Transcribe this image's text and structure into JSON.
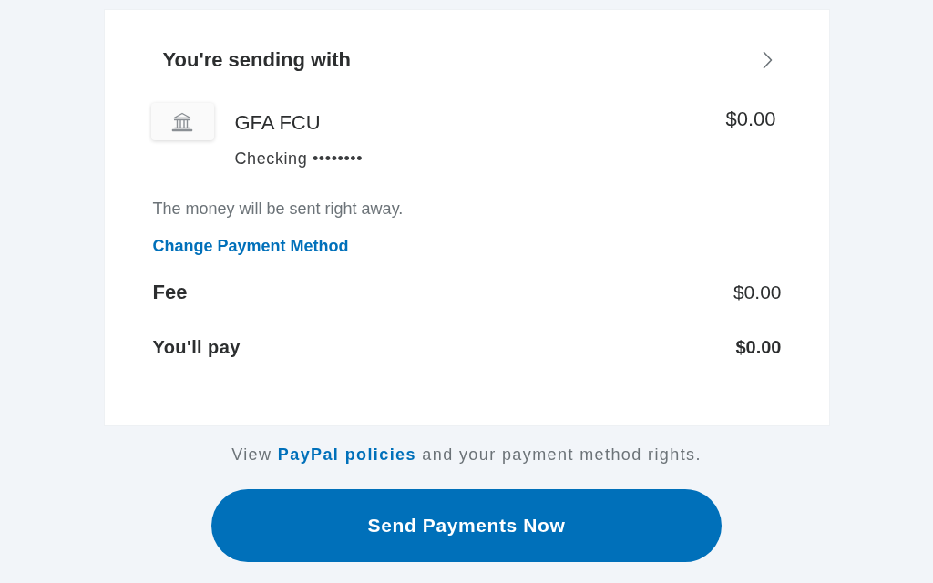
{
  "card": {
    "title": "You're sending with",
    "payment_method": {
      "name": "GFA FCU",
      "account": "Checking ••••••••",
      "amount": "$0.00"
    },
    "note": "The money will be sent right away.",
    "change_link": "Change Payment Method",
    "summary": [
      {
        "kind": "fee",
        "label": "Fee",
        "value": "$0.00"
      },
      {
        "kind": "total",
        "label": "You'll pay",
        "value": "$0.00"
      }
    ]
  },
  "policy": {
    "before": "View",
    "link": "PayPal policies",
    "after": "and your payment method rights."
  },
  "primary_button": "Send Payments Now"
}
